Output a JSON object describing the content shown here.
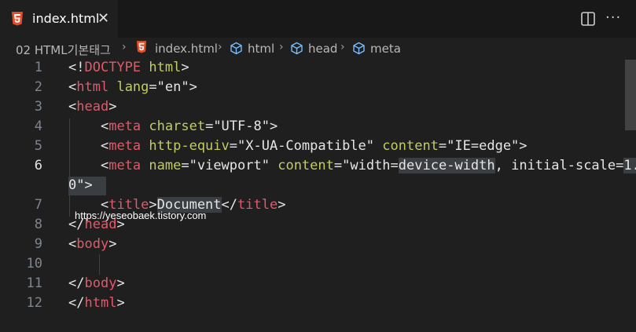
{
  "tab": {
    "title": "index.html",
    "close": "✕"
  },
  "toolbar": {
    "split_icon": "split-editor-icon",
    "more_label": "···"
  },
  "breadcrumb": {
    "folder": "02 HTML기본태그",
    "file": "index.html",
    "items": [
      "html",
      "head",
      "meta"
    ]
  },
  "editor": {
    "line_numbers": [
      "1",
      "2",
      "3",
      "4",
      "5",
      "6",
      "",
      "7",
      "8",
      "9",
      "10",
      "11",
      "12"
    ],
    "active_line": "6",
    "lines": [
      "<!DOCTYPE html>",
      "<html lang=\"en\">",
      "<head>",
      "    <meta charset=\"UTF-8\">",
      "    <meta http-equiv=\"X-UA-Compatible\" content=\"IE=edge\">",
      "    <meta name=\"viewport\" content=\"width=device-width, initial-scale=1.",
      "0\">",
      "    <title>Document</title>",
      "</head>",
      "<body>",
      "",
      "</body>",
      "</html>"
    ]
  },
  "watermark": "https://yeseobaek.tistory.com",
  "colors": {
    "tag": "#e05a6a",
    "attribute": "#c2cc62",
    "text": "#e6e6e6",
    "background": "#1f1f1f"
  }
}
